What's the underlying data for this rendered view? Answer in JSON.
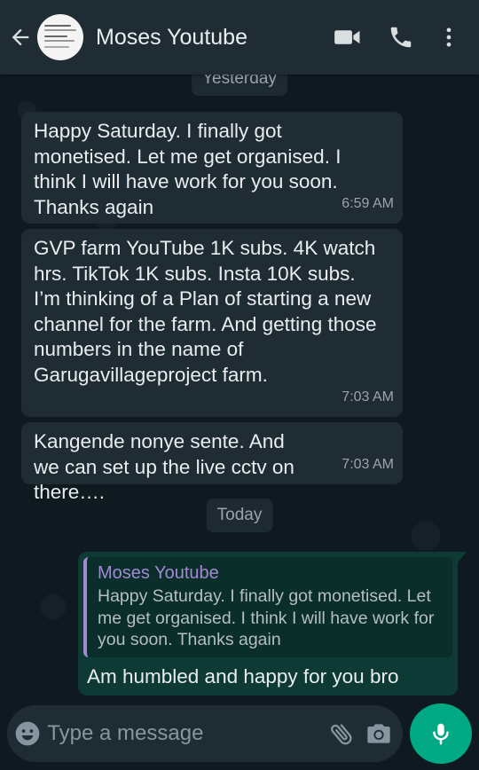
{
  "header": {
    "contact_name": "Moses Youtube",
    "icons": [
      "back-arrow-icon",
      "video-call-icon",
      "phone-icon",
      "more-vert-icon"
    ]
  },
  "chat": {
    "date_chips": {
      "yesterday": "Yesterday",
      "today": "Today"
    },
    "incoming": [
      {
        "text": "Happy Saturday. I finally got monetised. Let me get organised. I think I will have work for you soon. Thanks again",
        "time": "6:59 AM"
      },
      {
        "text": "GVP farm YouTube 1K subs. 4K watch hrs. TikTok 1K subs. Insta 10K subs. I’m thinking of a Plan of starting a new channel for the farm. And getting those numbers in the name of Garugavillageproject farm.",
        "time": "7:03 AM"
      },
      {
        "text": "Kangende nonye sente. And we can set up the live cctv on there….",
        "time": "7:03 AM"
      }
    ],
    "outgoing": {
      "quote_name": "Moses Youtube",
      "quote_text": "Happy Saturday. I finally got monetised. Let me get organised. I think I will have work for you soon. Thanks again",
      "text": "Am humbled and happy for you bro"
    }
  },
  "composer": {
    "placeholder": "Type a message",
    "icons": [
      "emoji-icon",
      "attach-icon",
      "camera-icon",
      "mic-icon"
    ]
  },
  "colors": {
    "header_bg": "#1f2c34",
    "incoming_bubble": "#1f2c34",
    "outgoing_bubble": "#0d3a34",
    "quote_accent": "#a389d4",
    "mic_button": "#00a884"
  }
}
